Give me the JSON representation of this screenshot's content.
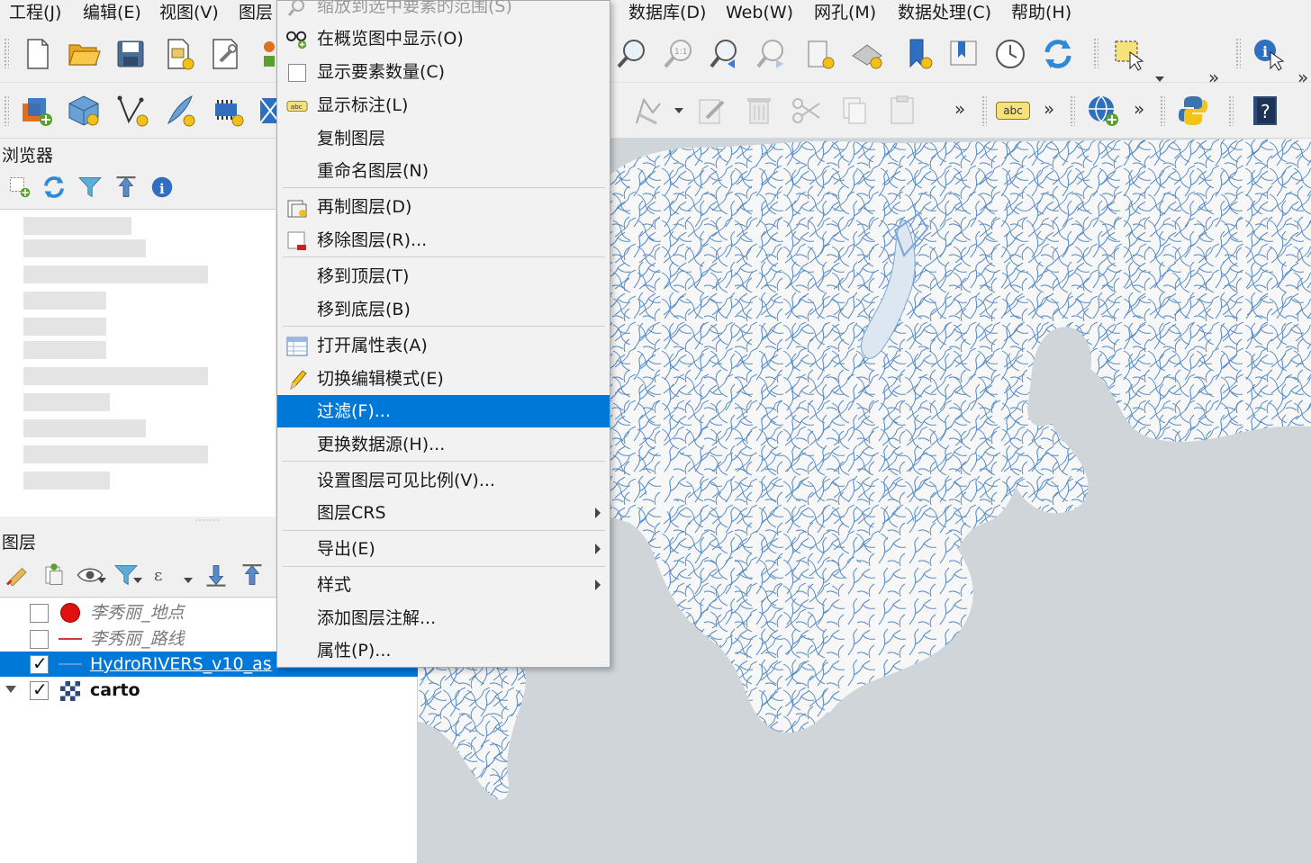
{
  "menubar": {
    "items": [
      "工程(J)",
      "编辑(E)",
      "视图(V)",
      "图层",
      "数据库(D)",
      "Web(W)",
      "网孔(M)",
      "数据处理(C)",
      "帮助(H)"
    ]
  },
  "browser_panel": {
    "title": "浏览器"
  },
  "layers_panel": {
    "title": "图层",
    "layers": [
      {
        "name": "李秀丽_地点",
        "checked": false,
        "style": "point",
        "symbol_color": "#e01010"
      },
      {
        "name": "李秀丽_路线",
        "checked": false,
        "style": "line",
        "symbol_color": "#d03a3a"
      },
      {
        "name": "HydroRIVERS_v10_as",
        "checked": true,
        "style": "line",
        "selected": true,
        "symbol_color": "#5b9bd5"
      },
      {
        "name": "carto",
        "checked": true,
        "style": "raster",
        "expanded": true
      }
    ]
  },
  "context_menu": {
    "items": [
      {
        "label": "缩放到选中要素的范围(S)",
        "icon": "zoom-selection-icon",
        "disabled": true
      },
      {
        "label": "在概览图中显示(O)",
        "icon": "overview-icon"
      },
      {
        "label": "显示要素数量(C)",
        "icon": "checkbox-icon"
      },
      {
        "label": "显示标注(L)",
        "icon": "label-abc-icon"
      },
      {
        "label": "复制图层",
        "icon": ""
      },
      {
        "label": "重命名图层(N)",
        "icon": ""
      },
      {
        "label": "再制图层(D)",
        "icon": "duplicate-layer-icon"
      },
      {
        "label": "移除图层(R)...",
        "icon": "remove-layer-icon"
      },
      {
        "label": "移到顶层(T)",
        "icon": ""
      },
      {
        "label": "移到底层(B)",
        "icon": ""
      },
      {
        "label": "打开属性表(A)",
        "icon": "attribute-table-icon"
      },
      {
        "label": "切换编辑模式(E)",
        "icon": "pencil-icon"
      },
      {
        "label": "过滤(F)...",
        "icon": "",
        "highlighted": true
      },
      {
        "label": "更换数据源(H)...",
        "icon": ""
      },
      {
        "label": "设置图层可见比例(V)...",
        "icon": ""
      },
      {
        "label": "图层CRS",
        "icon": "",
        "submenu": true
      },
      {
        "label": "导出(E)",
        "icon": "",
        "submenu": true
      },
      {
        "label": "样式",
        "icon": "",
        "submenu": true
      },
      {
        "label": "添加图层注解...",
        "icon": ""
      },
      {
        "label": "属性(P)...",
        "icon": ""
      }
    ]
  },
  "toolbar": {
    "label_button_text": "abc",
    "overflow_glyph": "»"
  },
  "colors": {
    "selection": "#0078d7",
    "river": "#5b8fc7",
    "land": "#f7f7f7",
    "water": "#cfd5d8"
  }
}
